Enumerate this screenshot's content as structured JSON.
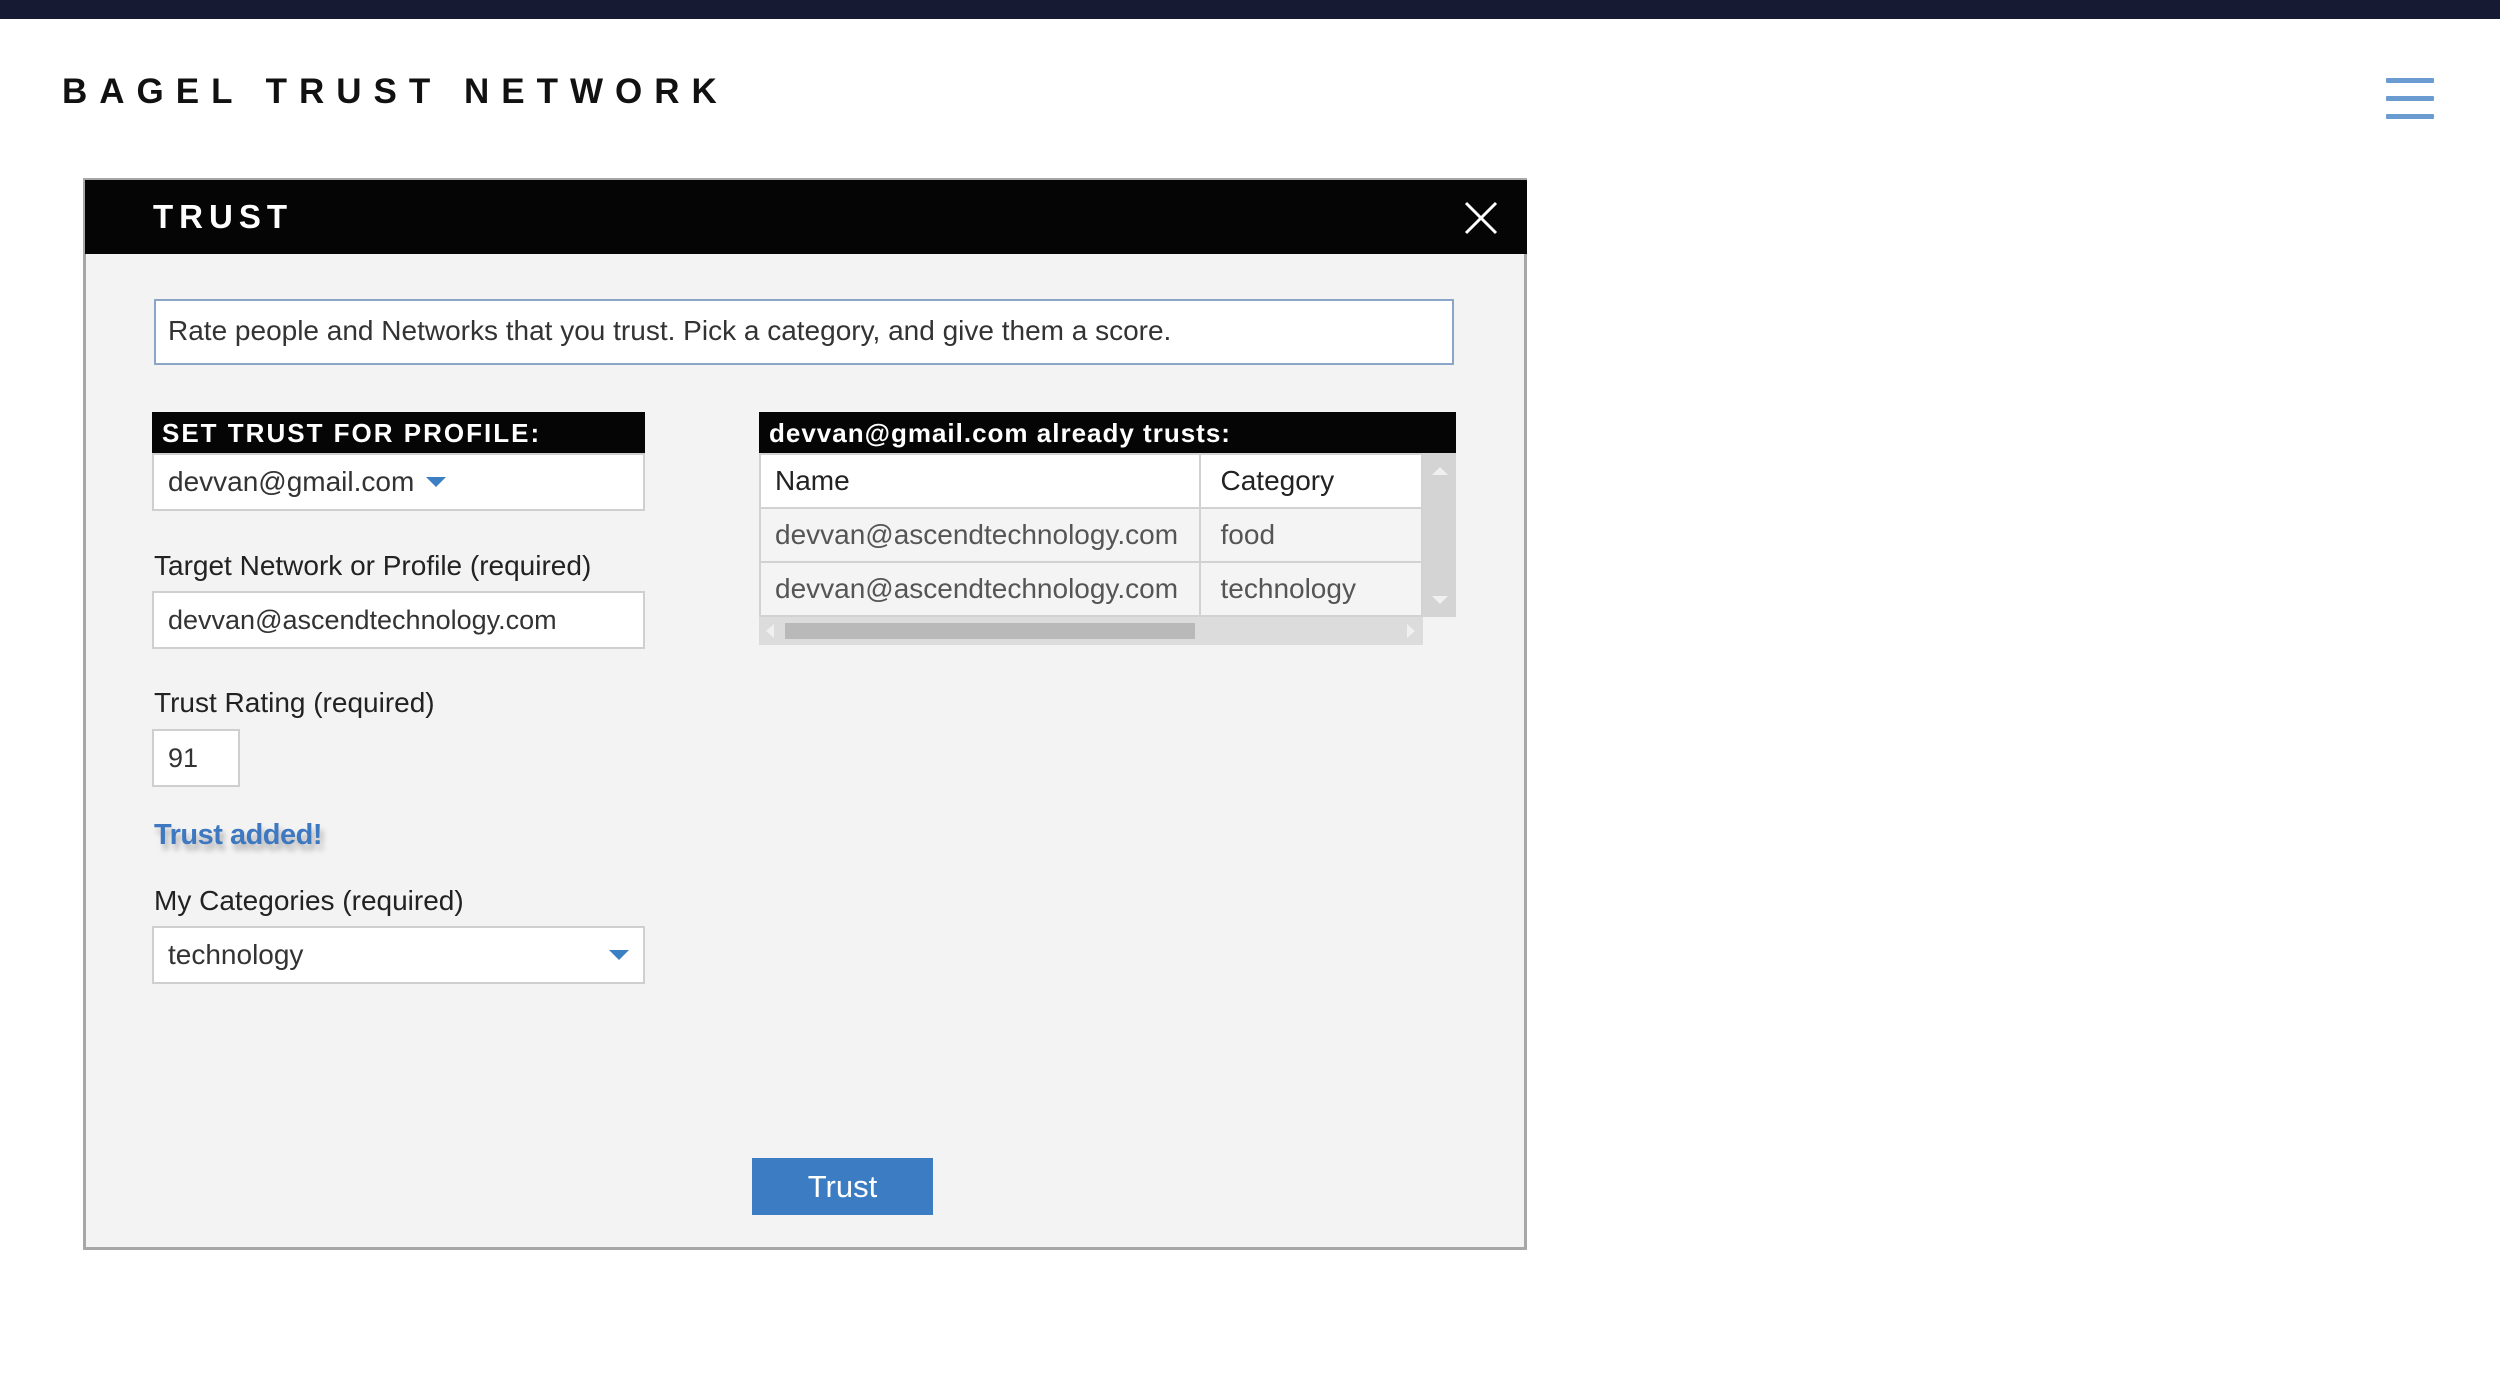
{
  "app": {
    "brand": "BAGEL TRUST NETWORK",
    "menu_icon": "hamburger-menu-icon"
  },
  "dialog": {
    "title": "TRUST",
    "close_icon": "close-icon",
    "intro": "Rate people and Networks that you trust. Pick a category, and give them a score."
  },
  "form": {
    "profile_section_label": "SET TRUST FOR PROFILE:",
    "profile_selected": "devvan@gmail.com",
    "target_label": "Target Network or Profile (required)",
    "target_value": "devvan@ascendtechnology.com",
    "rating_label": "Trust Rating (required)",
    "rating_value": "91",
    "status_message": "Trust added!",
    "categories_label": "My Categories (required)",
    "category_selected": "technology",
    "submit_label": "Trust"
  },
  "trusts_table": {
    "title": "devvan@gmail.com already trusts:",
    "columns": [
      "Name",
      "Category"
    ],
    "rows": [
      {
        "name": "devvan@ascendtechnology.com",
        "category": "food"
      },
      {
        "name": "devvan@ascendtechnology.com",
        "category": "technology"
      }
    ]
  },
  "colors": {
    "top_stripe": "#161a33",
    "accent_blue": "#3c7cc3",
    "header_black": "#050505",
    "menu_blue": "#6a9bd1"
  }
}
